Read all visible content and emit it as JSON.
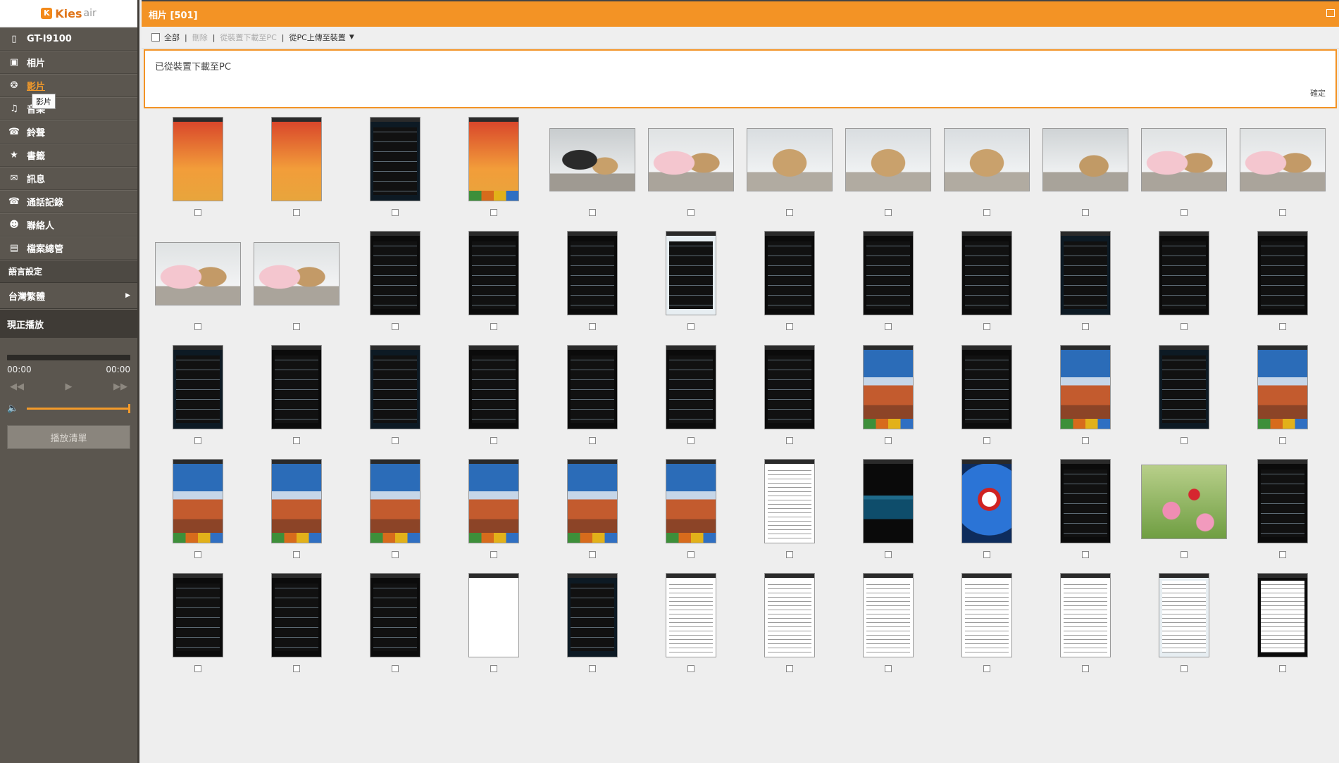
{
  "app": {
    "logo": "Kies",
    "logo_suffix": "air"
  },
  "sidebar": {
    "items": [
      {
        "label": "GT-I9100",
        "icon": "phone-icon",
        "name": "sidebar-item-device"
      },
      {
        "label": "相片",
        "icon": "photo-icon",
        "name": "sidebar-item-photos"
      },
      {
        "label": "影片",
        "icon": "video-icon",
        "name": "sidebar-item-videos",
        "active": true
      },
      {
        "label": "音樂",
        "icon": "music-icon",
        "name": "sidebar-item-music"
      },
      {
        "label": "鈴聲",
        "icon": "ringtone-icon",
        "name": "sidebar-item-ringtones"
      },
      {
        "label": "書籤",
        "icon": "bookmark-icon",
        "name": "sidebar-item-bookmarks"
      },
      {
        "label": "訊息",
        "icon": "message-icon",
        "name": "sidebar-item-messages"
      },
      {
        "label": "通話記錄",
        "icon": "call-log-icon",
        "name": "sidebar-item-call-log"
      },
      {
        "label": "聯絡人",
        "icon": "contacts-icon",
        "name": "sidebar-item-contacts"
      },
      {
        "label": "檔案總管",
        "icon": "folder-icon",
        "name": "sidebar-item-file-manager"
      }
    ],
    "tooltip": "影片",
    "language_section": "語言設定",
    "language_value": "台灣繁體",
    "now_playing": "現正播放",
    "player": {
      "time_current": "00:00",
      "time_total": "00:00",
      "volume_level": 1.0,
      "playlist_label": "播放清單"
    }
  },
  "main": {
    "title": "相片 [501]",
    "toolbar": {
      "select_all": "全部",
      "delete": "刪除",
      "download": "從裝置下載至PC",
      "upload": "從PC上傳至裝置"
    },
    "notice": {
      "message": "已從裝置下載至PC",
      "ok_label": "確定"
    },
    "thumbnails": [
      {
        "k": "portrait",
        "s": "t-dark",
        "o": "w-orange"
      },
      {
        "k": "portrait",
        "s": "t-dark",
        "o": "w-orange"
      },
      {
        "k": "portrait",
        "s": "t-ui",
        "o": "lines"
      },
      {
        "k": "portrait",
        "s": "t-dark",
        "o": "w-orange",
        "dock": true
      },
      {
        "k": "landscape",
        "s": "p-dark"
      },
      {
        "k": "landscape",
        "s": "p-pink"
      },
      {
        "k": "landscape",
        "s": "p-danbo2"
      },
      {
        "k": "landscape",
        "s": "p-danbo2"
      },
      {
        "k": "landscape",
        "s": "p-danbo2"
      },
      {
        "k": "landscape",
        "s": "p-danbo1"
      },
      {
        "k": "landscape",
        "s": "p-pink"
      },
      {
        "k": "landscape",
        "s": "p-pink"
      },
      {
        "k": "landscape",
        "s": "p-pink"
      },
      {
        "k": "landscape",
        "s": "p-pink"
      },
      {
        "k": "portrait",
        "s": "t-dark",
        "o": "lines"
      },
      {
        "k": "portrait",
        "s": "t-dark",
        "o": "lines"
      },
      {
        "k": "portrait",
        "s": "t-dark",
        "o": "lines"
      },
      {
        "k": "portrait",
        "s": "t-light",
        "o": "lines"
      },
      {
        "k": "portrait",
        "s": "t-dark",
        "o": "lines"
      },
      {
        "k": "portrait",
        "s": "t-dark",
        "o": "lines"
      },
      {
        "k": "portrait",
        "s": "t-dark",
        "o": "lines"
      },
      {
        "k": "portrait",
        "s": "t-ui",
        "o": "lines"
      },
      {
        "k": "portrait",
        "s": "t-dark",
        "o": "lines"
      },
      {
        "k": "portrait",
        "s": "t-dark",
        "o": "lines"
      },
      {
        "k": "portrait",
        "s": "t-ui",
        "o": "lines"
      },
      {
        "k": "portrait",
        "s": "t-dark",
        "o": "lines"
      },
      {
        "k": "portrait",
        "s": "t-ui",
        "o": "lines"
      },
      {
        "k": "portrait",
        "s": "t-dark",
        "o": "lines"
      },
      {
        "k": "portrait",
        "s": "t-dark",
        "o": "lines"
      },
      {
        "k": "portrait",
        "s": "t-dark",
        "o": "lines"
      },
      {
        "k": "portrait",
        "s": "t-dark",
        "o": "lines"
      },
      {
        "k": "portrait",
        "s": "t-dark",
        "o": "w-sky",
        "dock": true
      },
      {
        "k": "portrait",
        "s": "t-dark",
        "o": "lines"
      },
      {
        "k": "portrait",
        "s": "t-dark",
        "o": "w-sky",
        "dock": true
      },
      {
        "k": "portrait",
        "s": "t-ui",
        "o": "lines"
      },
      {
        "k": "portrait",
        "s": "t-light",
        "o": "w-sky",
        "dock": true
      },
      {
        "k": "portrait",
        "s": "t-light",
        "o": "w-sky",
        "dock": true
      },
      {
        "k": "portrait",
        "s": "t-light",
        "o": "w-sky",
        "dock": true
      },
      {
        "k": "portrait",
        "s": "t-light",
        "o": "w-sky",
        "dock": true
      },
      {
        "k": "portrait",
        "s": "t-dark",
        "o": "w-sky",
        "dock": true
      },
      {
        "k": "portrait",
        "s": "t-dark",
        "o": "w-sky",
        "dock": true
      },
      {
        "k": "portrait",
        "s": "t-dark",
        "o": "w-sky",
        "dock": true
      },
      {
        "k": "portrait",
        "s": "t-white",
        "o": "doc"
      },
      {
        "k": "portrait",
        "s": "t-dark",
        "o": "w-eq"
      },
      {
        "k": "portrait",
        "s": "t-dark",
        "o": "w-blue"
      },
      {
        "k": "portrait",
        "s": "t-dark",
        "o": "lines"
      },
      {
        "k": "flower",
        "s": "p-flower"
      },
      {
        "k": "portrait",
        "s": "t-dark",
        "o": "lines"
      },
      {
        "k": "portrait",
        "s": "t-dark",
        "o": "lines"
      },
      {
        "k": "portrait",
        "s": "t-dark",
        "o": "lines"
      },
      {
        "k": "portrait",
        "s": "t-dark",
        "o": "lines"
      },
      {
        "k": "portrait",
        "s": "t-white"
      },
      {
        "k": "portrait",
        "s": "t-ui",
        "o": "lines"
      },
      {
        "k": "portrait",
        "s": "t-white",
        "o": "doc"
      },
      {
        "k": "portrait",
        "s": "t-white",
        "o": "doc"
      },
      {
        "k": "portrait",
        "s": "t-white",
        "o": "doc"
      },
      {
        "k": "portrait",
        "s": "t-white",
        "o": "doc"
      },
      {
        "k": "portrait",
        "s": "t-white",
        "o": "doc"
      },
      {
        "k": "portrait",
        "s": "t-light",
        "o": "doc"
      },
      {
        "k": "portrait",
        "s": "t-dark",
        "o": "doc"
      }
    ]
  },
  "colors": {
    "accent": "#f39325",
    "sidebar_bg": "#5b564f",
    "content_bg": "#eeeeee",
    "active_text": "#f39a2a"
  }
}
